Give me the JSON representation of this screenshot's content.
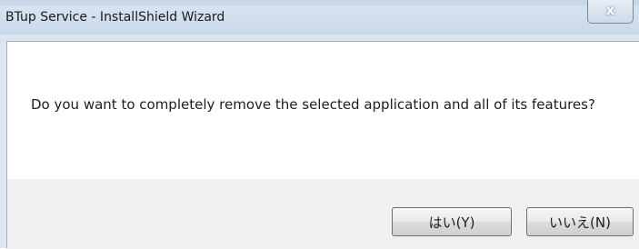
{
  "window": {
    "title": "BTup Service - InstallShield Wizard",
    "close_glyph": "x"
  },
  "dialog": {
    "message": "Do you want to completely remove the selected application and all of its features?"
  },
  "buttons": {
    "yes_label": "はい(Y)",
    "no_label": "いいえ(N)"
  },
  "colors": {
    "titlebar": "#c9d8ea",
    "button_area": "#f0f0f0",
    "client": "#ffffff"
  }
}
